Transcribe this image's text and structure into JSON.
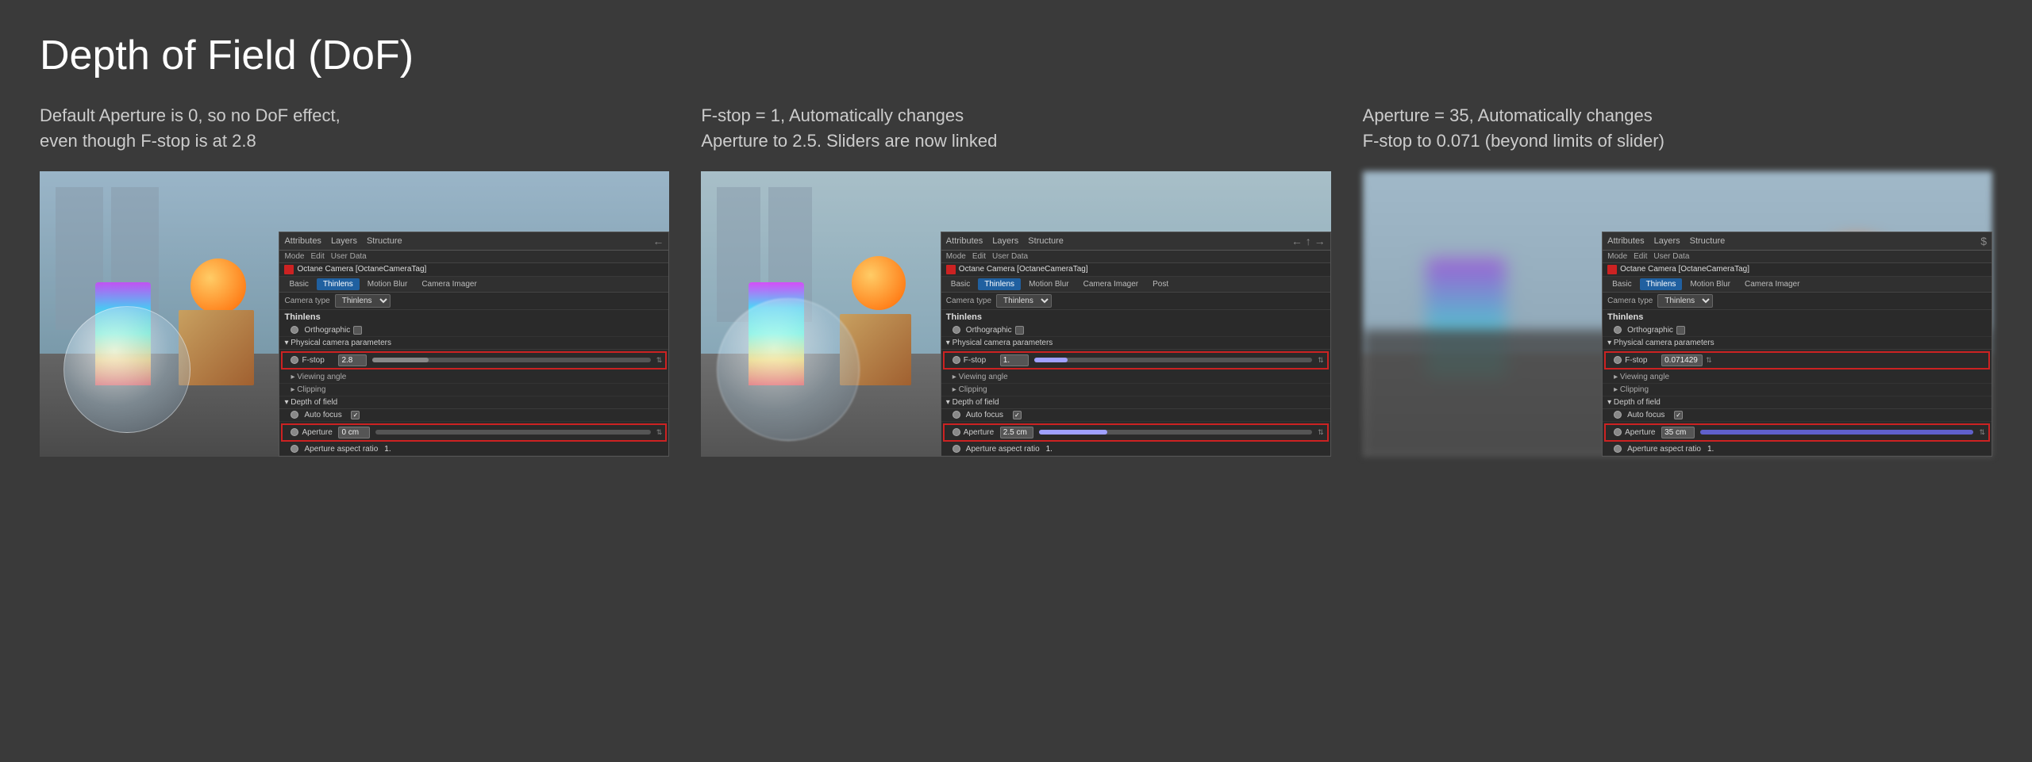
{
  "page": {
    "title": "Depth of Field (DoF)"
  },
  "columns": [
    {
      "id": "col1",
      "description_line1": "Default Aperture is 0, so no DoF effect,",
      "description_line2": "even though F-stop is at 2.8",
      "panel": {
        "tabs": [
          "Attributes",
          "Layers",
          "Structure"
        ],
        "toolbar": [
          "Mode",
          "Edit",
          "User Data"
        ],
        "object_name": "Octane Camera [OctaneCameraTag]",
        "sub_tabs": [
          "Basic",
          "Thinlens",
          "Motion Blur",
          "Camera Imager"
        ],
        "active_sub_tab": "Thinlens",
        "camera_type_label": "Camera type",
        "camera_type_value": "Thinlens",
        "section_thinlens": "Thinlens",
        "orthographic_label": "Orthographic",
        "physical_params_label": "▾ Physical camera parameters",
        "fstop_label": "F-stop",
        "fstop_value": "2.8",
        "viewing_angle_label": "▸ Viewing angle",
        "clipping_label": "▸ Clipping",
        "depth_of_field_label": "▾ Depth of field",
        "auto_focus_label": "Auto focus",
        "auto_focus_checked": true,
        "aperture_label": "Aperture",
        "aperture_value": "0 cm",
        "aperture_aspect_ratio_label": "Aperture aspect ratio",
        "aperture_aspect_ratio_value": "1."
      }
    },
    {
      "id": "col2",
      "description_line1": "F-stop = 1, Automatically changes",
      "description_line2": "Aperture to 2.5. Sliders are now linked",
      "panel": {
        "tabs": [
          "Attributes",
          "Layers",
          "Structure"
        ],
        "toolbar": [
          "Mode",
          "Edit",
          "User Data"
        ],
        "object_name": "Octane Camera [OctaneCameraTag]",
        "sub_tabs": [
          "Basic",
          "Thinlens",
          "Motion Blur",
          "Camera Imager",
          "Post"
        ],
        "active_sub_tab": "Thinlens",
        "camera_type_label": "Camera type",
        "camera_type_value": "Thinlens",
        "section_thinlens": "Thinlens",
        "orthographic_label": "Orthographic",
        "physical_params_label": "▾ Physical camera parameters",
        "fstop_label": "F-stop",
        "fstop_value": "1.",
        "viewing_angle_label": "▸ Viewing angle",
        "clipping_label": "▸ Clipping",
        "depth_of_field_label": "▾ Depth of field",
        "auto_focus_label": "Auto focus",
        "auto_focus_checked": true,
        "aperture_label": "Aperture",
        "aperture_value": "2.5 cm",
        "aperture_aspect_ratio_label": "Aperture aspect ratio",
        "aperture_aspect_ratio_value": "1."
      }
    },
    {
      "id": "col3",
      "description_line1": "Aperture = 35, Automatically changes",
      "description_line2": "F-stop to 0.071 (beyond limits of slider)",
      "panel": {
        "tabs": [
          "Attributes",
          "Layers",
          "Structure"
        ],
        "toolbar": [
          "Mode",
          "Edit",
          "User Data"
        ],
        "object_name": "Octane Camera [OctaneCameraTag]",
        "sub_tabs": [
          "Basic",
          "Thinlens",
          "Motion Blur",
          "Camera Imager"
        ],
        "active_sub_tab": "Thinlens",
        "camera_type_label": "Camera type",
        "camera_type_value": "Thinlens",
        "section_thinlens": "Thinlens",
        "orthographic_label": "Orthographic",
        "physical_params_label": "▾ Physical camera parameters",
        "fstop_label": "F-stop",
        "fstop_value": "0.071429",
        "viewing_angle_label": "▸ Viewing angle",
        "clipping_label": "▸ Clipping",
        "depth_of_field_label": "▾ Depth of field",
        "auto_focus_label": "Auto focus",
        "auto_focus_checked": true,
        "aperture_label": "Aperture",
        "aperture_value": "35 cm",
        "aperture_aspect_ratio_label": "Aperture aspect ratio",
        "aperture_aspect_ratio_value": "1."
      }
    }
  ]
}
